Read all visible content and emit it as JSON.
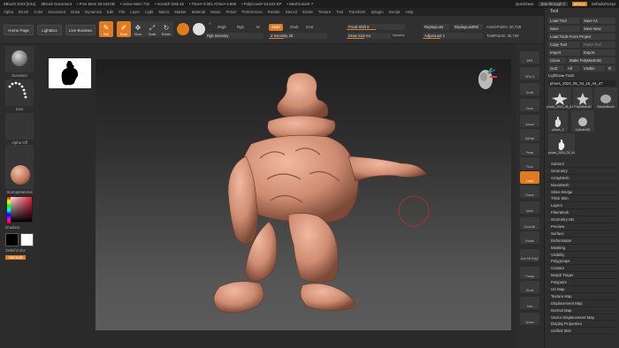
{
  "titlebar": {
    "app": "ZBrush 2023 [m1x]",
    "doc": "ZBrush Document",
    "free_mem": "• Free Mem 20.044GB",
    "active_mem": "• Active Mem 732",
    "scratch": "• Scratch Disk 45",
    "timer": "• Timer• 0.001 ATime• 6.895",
    "polycount": "• PolyCount• 53.842 KP",
    "meshcount": "• MeshCount• 7",
    "quicksave": "QuickSave",
    "see_through": "See-through 0",
    "menus": "Menus",
    "default_script": "DefaultZScript"
  },
  "menubar": [
    "Alpha",
    "Brush",
    "Color",
    "Document",
    "Draw",
    "Dynamics",
    "Edit",
    "File",
    "Layer",
    "Light",
    "Macro",
    "Marker",
    "Material",
    "Movie",
    "Picker",
    "Preferences",
    "Render",
    "Stencil",
    "Stroke",
    "Texture",
    "Tool",
    "Transform",
    "Zplugin",
    "Zscript",
    "Help"
  ],
  "toolbar": {
    "home_page": "Home Page",
    "lightbox": "LightBox",
    "live_boolean": "Live Boolean",
    "tools": [
      {
        "label": "Edit",
        "glyph": "✎",
        "active": true
      },
      {
        "label": "Draw",
        "glyph": "✐",
        "active": true
      },
      {
        "label": "Move",
        "glyph": "✥",
        "active": false
      },
      {
        "label": "Scale",
        "glyph": "⤢",
        "active": false
      },
      {
        "label": "Rotate",
        "glyph": "↻",
        "active": false
      }
    ],
    "mrgb": "Mrgb",
    "rgb": "Rgb",
    "m": "M",
    "zadd": "Zadd",
    "zsub": "Zsub",
    "zcut": "Zcut",
    "rgb_intensity": "Rgb Intensity",
    "z_intensity": "Z Intensity 25",
    "focal_shift": "Focal Shift 0",
    "draw_size": "Draw Size 64",
    "dynamic": "Dynamic",
    "replay_last": "ReplayLast",
    "replay_last_rel": "ReplayLastRel",
    "adjust_last": "AdjustLast 1",
    "active_points": "ActivePoints: 30,728",
    "total_points": "TotalPoints: 30,728"
  },
  "leftshelf": {
    "standard": "Standard",
    "dots": "Dots",
    "alpha_off": "Alpha Off",
    "texture_off": "Texture Off",
    "material": "StartupMaterial",
    "gradient": "Gradient",
    "switch_color": "SwitchColor",
    "alternate": "Alternate"
  },
  "rshelf": [
    "BPR",
    "SPix 3",
    "Scroll",
    "Zoom",
    "Actual",
    "AAHalf",
    "Persp",
    "Floor",
    "Local",
    "Frame",
    "Move",
    "Zoom3D",
    "Rotate",
    "Line Fill PolyF",
    "Transp",
    "Ghost",
    "Solo",
    "Xpose"
  ],
  "toolpanel": {
    "title": "Tool",
    "load_tool": "Load Tool",
    "save_as": "Save As",
    "save": "Save",
    "save_new": "Save New",
    "load_tools_project": "Load Tools From Project",
    "copy_tool": "Copy Tool",
    "paste_tool": "Paste Tool",
    "import": "Import",
    "export": "Export",
    "clone": "Clone",
    "make_polymesh": "Make PolyMesh3D",
    "goz": "GoZ",
    "all": "All",
    "visible": "Visible",
    "r": "R",
    "lightbox_tools": "Lightbox▸ Tools",
    "current_tool": "phoes_2024_05_04_16_44_47",
    "subtools": [
      {
        "label": "phoes_2024_05_04"
      },
      {
        "label": "PolyMesh3D"
      },
      {
        "label": "SimpleBrush"
      },
      {
        "label": "phoes_2"
      },
      {
        "label": "Cylinder3D"
      },
      {
        "label": "phoes_2024_05_04"
      }
    ],
    "palette": [
      "Subtool",
      "Geometry",
      "ArrayMesh",
      "NanoMesh",
      "Slime Bridge",
      "Thick Skin",
      "Layers",
      "FiberMesh",
      "Geometry HD",
      "Preview",
      "Surface",
      "Deformation",
      "Masking",
      "Visibility",
      "Polygroups",
      "Contact",
      "Morph Target",
      "Polypaint",
      "UV Map",
      "Texture Map",
      "Displacement Map",
      "Normal Map",
      "Vector Displacement Map",
      "Display Properties",
      "Unified Skin"
    ]
  },
  "colors": {
    "accent": "#e07c1f",
    "model": "#d89a82",
    "background": "#2b2b2b"
  }
}
